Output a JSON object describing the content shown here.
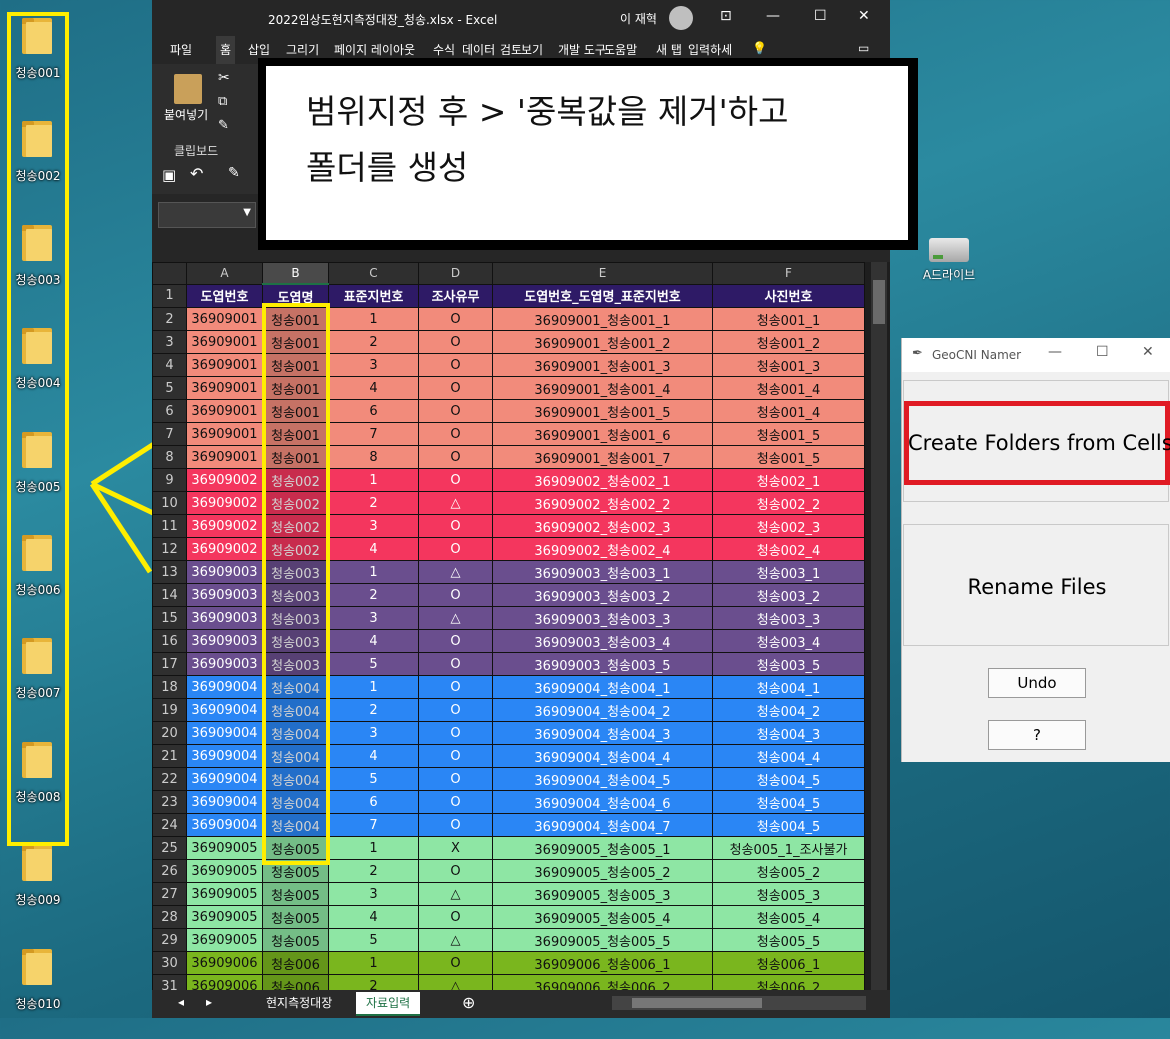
{
  "desktop": {
    "folders": [
      "청송001",
      "청송002",
      "청송003",
      "청송004",
      "청송005",
      "청송006",
      "청송007",
      "청송008",
      "청송009",
      "청송010"
    ],
    "drive_label": "A드라이브"
  },
  "excel": {
    "title": "2022임상도현지측정대장_청송.xlsx  -  Excel",
    "user": "이 재혁",
    "menus": [
      "파일",
      "홈",
      "삽입",
      "그리기",
      "페이지 레이아웃",
      "수식",
      "데이터",
      "검토",
      "보기",
      "개발 도구",
      "도움말",
      "새 탭",
      "입력하세"
    ],
    "active_menu_index": 1,
    "ribbon": {
      "paste_label": "붙여넣기",
      "clipboard_label": "클립보드"
    },
    "columns": [
      "A",
      "B",
      "C",
      "D",
      "E",
      "F"
    ],
    "header_row": [
      "도엽번호",
      "도엽명",
      "표준지번호",
      "조사유무",
      "도엽번호_도엽명_표준지번호",
      "사진번호"
    ],
    "rows": [
      [
        "36909001",
        "청송001",
        "1",
        "O",
        "36909001_청송001_1",
        "청송001_1"
      ],
      [
        "36909001",
        "청송001",
        "2",
        "O",
        "36909001_청송001_2",
        "청송001_2"
      ],
      [
        "36909001",
        "청송001",
        "3",
        "O",
        "36909001_청송001_3",
        "청송001_3"
      ],
      [
        "36909001",
        "청송001",
        "4",
        "O",
        "36909001_청송001_4",
        "청송001_4"
      ],
      [
        "36909001",
        "청송001",
        "6",
        "O",
        "36909001_청송001_5",
        "청송001_4"
      ],
      [
        "36909001",
        "청송001",
        "7",
        "O",
        "36909001_청송001_6",
        "청송001_5"
      ],
      [
        "36909001",
        "청송001",
        "8",
        "O",
        "36909001_청송001_7",
        "청송001_5"
      ],
      [
        "36909002",
        "청송002",
        "1",
        "O",
        "36909002_청송002_1",
        "청송002_1"
      ],
      [
        "36909002",
        "청송002",
        "2",
        "△",
        "36909002_청송002_2",
        "청송002_2"
      ],
      [
        "36909002",
        "청송002",
        "3",
        "O",
        "36909002_청송002_3",
        "청송002_3"
      ],
      [
        "36909002",
        "청송002",
        "4",
        "O",
        "36909002_청송002_4",
        "청송002_4"
      ],
      [
        "36909003",
        "청송003",
        "1",
        "△",
        "36909003_청송003_1",
        "청송003_1"
      ],
      [
        "36909003",
        "청송003",
        "2",
        "O",
        "36909003_청송003_2",
        "청송003_2"
      ],
      [
        "36909003",
        "청송003",
        "3",
        "△",
        "36909003_청송003_3",
        "청송003_3"
      ],
      [
        "36909003",
        "청송003",
        "4",
        "O",
        "36909003_청송003_4",
        "청송003_4"
      ],
      [
        "36909003",
        "청송003",
        "5",
        "O",
        "36909003_청송003_5",
        "청송003_5"
      ],
      [
        "36909004",
        "청송004",
        "1",
        "O",
        "36909004_청송004_1",
        "청송004_1"
      ],
      [
        "36909004",
        "청송004",
        "2",
        "O",
        "36909004_청송004_2",
        "청송004_2"
      ],
      [
        "36909004",
        "청송004",
        "3",
        "O",
        "36909004_청송004_3",
        "청송004_3"
      ],
      [
        "36909004",
        "청송004",
        "4",
        "O",
        "36909004_청송004_4",
        "청송004_4"
      ],
      [
        "36909004",
        "청송004",
        "5",
        "O",
        "36909004_청송004_5",
        "청송004_5"
      ],
      [
        "36909004",
        "청송004",
        "6",
        "O",
        "36909004_청송004_6",
        "청송004_5"
      ],
      [
        "36909004",
        "청송004",
        "7",
        "O",
        "36909004_청송004_7",
        "청송004_5"
      ],
      [
        "36909005",
        "청송005",
        "1",
        "X",
        "36909005_청송005_1",
        "청송005_1_조사불가"
      ],
      [
        "36909005",
        "청송005",
        "2",
        "O",
        "36909005_청송005_2",
        "청송005_2"
      ],
      [
        "36909005",
        "청송005",
        "3",
        "△",
        "36909005_청송005_3",
        "청송005_3"
      ],
      [
        "36909005",
        "청송005",
        "4",
        "O",
        "36909005_청송005_4",
        "청송005_4"
      ],
      [
        "36909005",
        "청송005",
        "5",
        "△",
        "36909005_청송005_5",
        "청송005_5"
      ],
      [
        "36909006",
        "청송006",
        "1",
        "O",
        "36909006_청송006_1",
        "청송006_1"
      ],
      [
        "36909006",
        "청송006",
        "2",
        "△",
        "36909006_청송006_2",
        "청송006_2"
      ]
    ],
    "group_colors": {
      "header": "#2e1a66",
      "36909001": "#f28b7b",
      "36909002": "#f4365e",
      "36909003": "#6a4e8e",
      "36909004": "#2a86f5",
      "36909005": "#8ee6a4",
      "36909006": "#7ab61e"
    },
    "sheets": [
      "현지측정대장",
      "자료입력"
    ],
    "active_sheet_index": 1
  },
  "callout": {
    "line1": "범위지정 후 > '중복값을 제거'하고",
    "line2": "폴더를 생성"
  },
  "app": {
    "title": "GeoCNI Namer",
    "create_button": "Create Folders from Cells",
    "rename_button": "Rename Files",
    "undo_button": "Undo",
    "help_button": "?"
  }
}
